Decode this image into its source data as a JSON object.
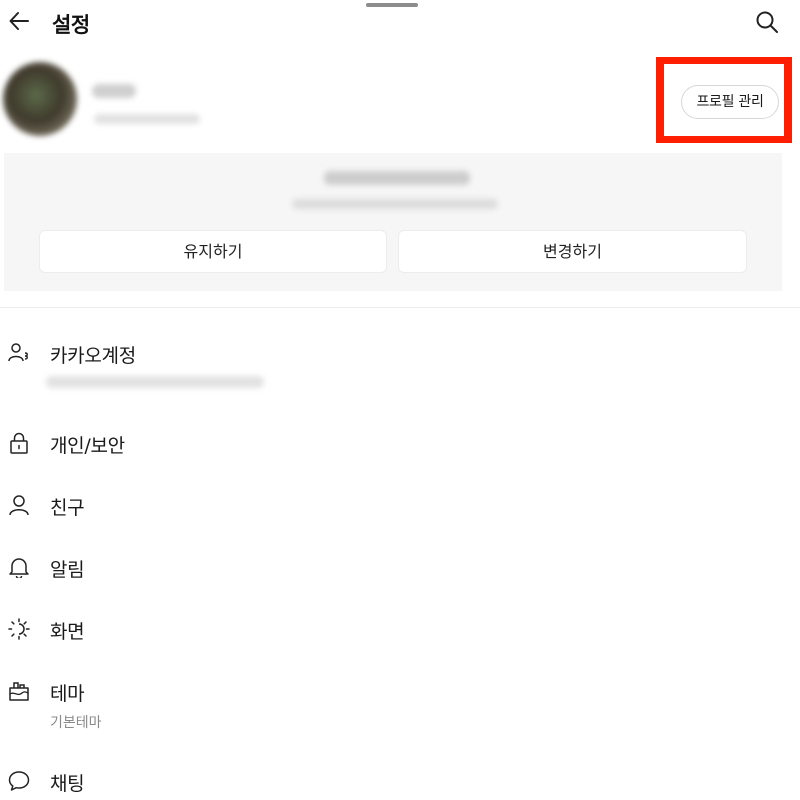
{
  "header": {
    "title": "설정",
    "back_icon": "arrow-left-icon",
    "search_icon": "search-icon"
  },
  "profile": {
    "manage_label": "프로필 관리"
  },
  "notice": {
    "keep_label": "유지하기",
    "change_label": "변경하기"
  },
  "menu": {
    "items": [
      {
        "label": "카카오계정",
        "icon": "account-icon"
      },
      {
        "label": "개인/보안",
        "icon": "lock-icon"
      },
      {
        "label": "친구",
        "icon": "person-icon"
      },
      {
        "label": "알림",
        "icon": "bell-icon"
      },
      {
        "label": "화면",
        "icon": "brightness-icon"
      },
      {
        "label": "테마",
        "icon": "theme-icon",
        "sub": "기본테마"
      },
      {
        "label": "채팅",
        "icon": "chat-bubble-icon"
      }
    ]
  },
  "colors": {
    "highlight": "#ff1e00",
    "panel_bg": "#f6f6f6",
    "text": "#1a1a1a",
    "sub_text": "#8a8a8a"
  }
}
